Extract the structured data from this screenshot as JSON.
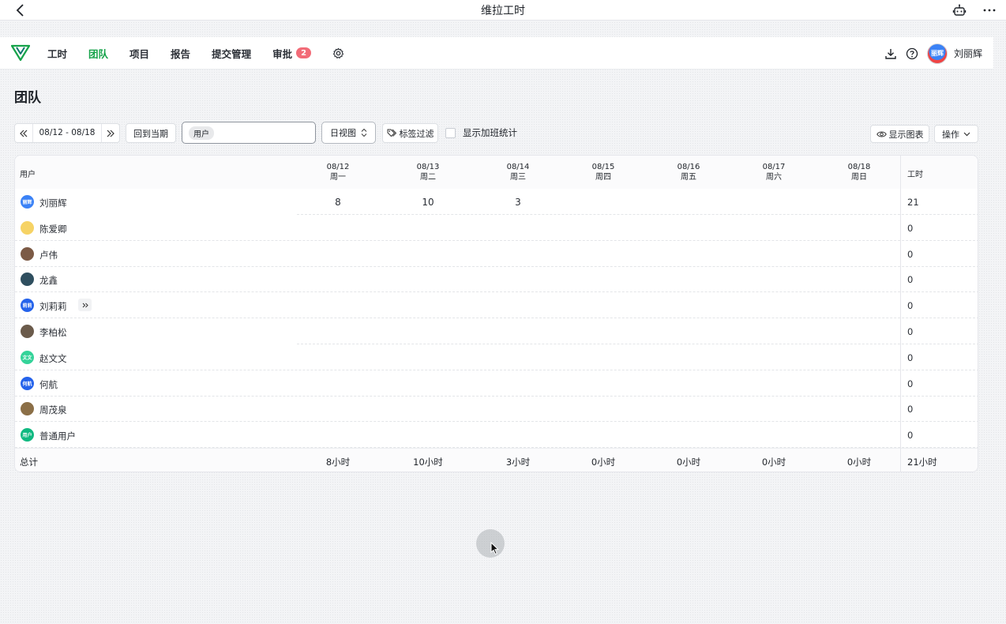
{
  "window": {
    "title": "维拉工时"
  },
  "nav": {
    "items": [
      {
        "label": "工时",
        "active": false
      },
      {
        "label": "团队",
        "active": true
      },
      {
        "label": "项目",
        "active": false
      },
      {
        "label": "报告",
        "active": false
      },
      {
        "label": "提交管理",
        "active": false
      },
      {
        "label": "审批",
        "active": false,
        "badge": "2"
      }
    ],
    "user": {
      "name": "刘丽辉",
      "avatar_text": "丽辉"
    },
    "accent_color": "#16a34a",
    "badge_color": "#f26b77"
  },
  "page": {
    "title": "团队"
  },
  "toolbar": {
    "date_range": "08/12 - 08/18",
    "current_label": "回到当期",
    "search_tag": "用户",
    "view_label": "日视图",
    "tag_filter_label": "标签过滤",
    "overtime_label": "显示加班统计",
    "overtime_checked": false,
    "show_chart_label": "显示图表",
    "action_label": "操作"
  },
  "table": {
    "user_header": "用户",
    "total_header": "工时",
    "days": [
      {
        "date": "08/12",
        "weekday": "周一"
      },
      {
        "date": "08/13",
        "weekday": "周二"
      },
      {
        "date": "08/14",
        "weekday": "周三"
      },
      {
        "date": "08/15",
        "weekday": "周四"
      },
      {
        "date": "08/16",
        "weekday": "周五"
      },
      {
        "date": "08/17",
        "weekday": "周六"
      },
      {
        "date": "08/18",
        "weekday": "周日"
      }
    ],
    "rows": [
      {
        "name": "刘丽辉",
        "avatar_text": "丽辉",
        "avatar_color": "#3b82f6",
        "hours": [
          "8",
          "10",
          "3",
          "",
          "",
          "",
          ""
        ],
        "total": "21"
      },
      {
        "name": "陈爱卿",
        "avatar_text": "",
        "avatar_color": "#f6d365",
        "hours": [
          "",
          "",
          "",
          "",
          "",
          "",
          ""
        ],
        "total": "0"
      },
      {
        "name": "卢伟",
        "avatar_text": "",
        "avatar_color": "#7c5a45",
        "hours": [
          "",
          "",
          "",
          "",
          "",
          "",
          ""
        ],
        "total": "0"
      },
      {
        "name": "龙鑫",
        "avatar_text": "",
        "avatar_color": "#2f4f5f",
        "hours": [
          "",
          "",
          "",
          "",
          "",
          "",
          ""
        ],
        "total": "0"
      },
      {
        "name": "刘莉莉",
        "avatar_text": "莉莉",
        "avatar_color": "#2563eb",
        "hours": [
          "",
          "",
          "",
          "",
          "",
          "",
          ""
        ],
        "total": "0",
        "expandable": true
      },
      {
        "name": "李柏松",
        "avatar_text": "",
        "avatar_color": "#6b5b4b",
        "hours": [
          "",
          "",
          "",
          "",
          "",
          "",
          ""
        ],
        "total": "0"
      },
      {
        "name": "赵文文",
        "avatar_text": "文文",
        "avatar_color": "#34d399",
        "hours": [
          "",
          "",
          "",
          "",
          "",
          "",
          ""
        ],
        "total": "0"
      },
      {
        "name": "何航",
        "avatar_text": "何航",
        "avatar_color": "#2563eb",
        "hours": [
          "",
          "",
          "",
          "",
          "",
          "",
          ""
        ],
        "total": "0"
      },
      {
        "name": "周茂泉",
        "avatar_text": "",
        "avatar_color": "#8b6f47",
        "hours": [
          "",
          "",
          "",
          "",
          "",
          "",
          ""
        ],
        "total": "0"
      },
      {
        "name": "普通用户",
        "avatar_text": "用户",
        "avatar_color": "#10b981",
        "hours": [
          "",
          "",
          "",
          "",
          "",
          "",
          ""
        ],
        "total": "0"
      }
    ],
    "footer": {
      "label": "总计",
      "totals": [
        "8小时",
        "10小时",
        "3小时",
        "0小时",
        "0小时",
        "0小时",
        "0小时"
      ],
      "grand_total": "21小时"
    }
  }
}
